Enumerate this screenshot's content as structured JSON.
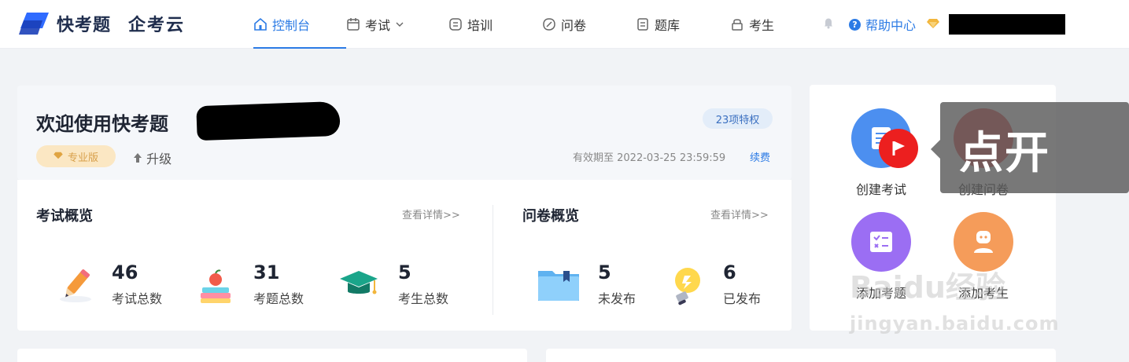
{
  "brand": {
    "name": "快考题",
    "partner": "企考云"
  },
  "nav": [
    {
      "label": "控制台",
      "icon": "home-icon",
      "active": true
    },
    {
      "label": "考试",
      "icon": "calendar-icon",
      "dropdown": true
    },
    {
      "label": "培训",
      "icon": "training-icon"
    },
    {
      "label": "问卷",
      "icon": "survey-icon"
    },
    {
      "label": "题库",
      "icon": "question-bank-icon"
    },
    {
      "label": "考生",
      "icon": "candidate-icon"
    }
  ],
  "header_right": {
    "help_label": "帮助中心"
  },
  "welcome": {
    "title": "欢迎使用快考题",
    "edition": "专业版",
    "upgrade": "升级",
    "privileges": "23项特权",
    "expiry": "有效期至 2022-03-25 23:59:59",
    "renew": "续费"
  },
  "exam_overview": {
    "title": "考试概览",
    "link": "查看详情>>",
    "stats": [
      {
        "value": "46",
        "label": "考试总数"
      },
      {
        "value": "31",
        "label": "考题总数"
      },
      {
        "value": "5",
        "label": "考生总数"
      }
    ]
  },
  "survey_overview": {
    "title": "问卷概览",
    "link": "查看详情>>",
    "stats": [
      {
        "value": "5",
        "label": "未发布"
      },
      {
        "value": "6",
        "label": "已发布"
      }
    ]
  },
  "quick_actions": [
    {
      "label": "创建考试",
      "color": "#4c8ff0"
    },
    {
      "label": "创建问卷",
      "color": "#e94e4e"
    },
    {
      "label": "添加考题",
      "color": "#9b6ef3"
    },
    {
      "label": "添加考生",
      "color": "#f59c5a"
    }
  ],
  "overlay": {
    "text": "点开"
  },
  "watermark": {
    "line1": "Baidu经验",
    "line2": "jingyan.baidu.com"
  },
  "colors": {
    "accent": "#2c7be5",
    "bg": "#f1f3f6"
  }
}
